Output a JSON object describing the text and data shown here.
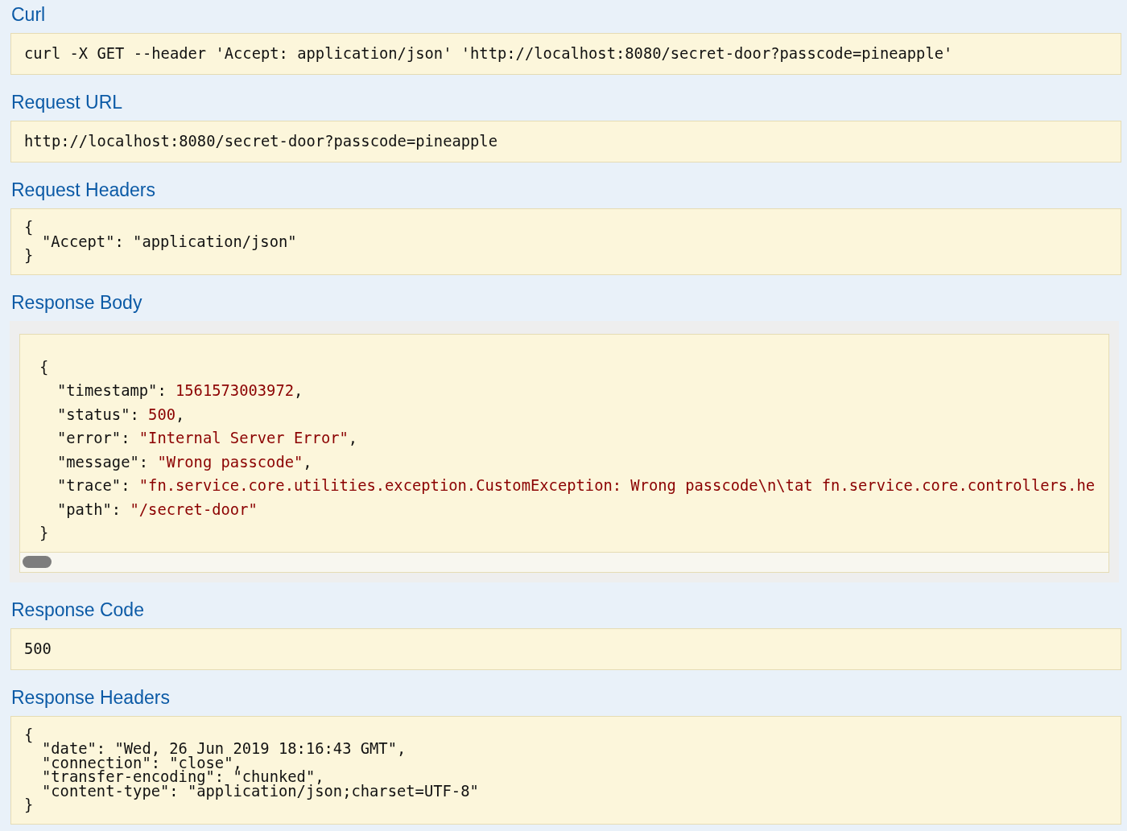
{
  "sections": [
    {
      "kind": "text",
      "title": "Curl",
      "lines": [
        "curl -X GET --header 'Accept: application/json' 'http://localhost:8080/secret-door?passcode=pineapple'"
      ]
    },
    {
      "kind": "text",
      "title": "Request URL",
      "lines": [
        "http://localhost:8080/secret-door?passcode=pineapple"
      ]
    },
    {
      "kind": "headers",
      "title": "Request Headers",
      "open": "{",
      "close": "}",
      "lines": [
        "\"Accept\": \"application/json\""
      ]
    },
    {
      "kind": "body",
      "title": "Response Body",
      "open": "{",
      "close": "}",
      "entries": [
        {
          "key": "\"timestamp\": ",
          "value": "1561573003972",
          "end": ","
        },
        {
          "key": "\"status\": ",
          "value": "500",
          "end": ","
        },
        {
          "key": "\"error\": ",
          "value": "\"Internal Server Error\"",
          "end": ","
        },
        {
          "key": "\"message\": ",
          "value": "\"Wrong passcode\"",
          "end": ","
        },
        {
          "key": "\"trace\": ",
          "value": "\"fn.service.core.utilities.exception.CustomException: Wrong passcode\\n\\tat fn.service.core.controllers.he"
        },
        {
          "key": "\"path\": ",
          "value": "\"/secret-door\""
        }
      ]
    },
    {
      "kind": "text",
      "title": "Response Code",
      "lines": [
        "500"
      ]
    },
    {
      "kind": "headers",
      "title": "Response Headers",
      "open": "{",
      "close": "}",
      "lines": [
        "\"date\": \"Wed, 26 Jun 2019 18:16:43 GMT\",",
        "\"connection\": \"close\",",
        "\"transfer-encoding\": \"chunked\",",
        "\"content-type\": \"application/json;charset=UTF-8\""
      ]
    }
  ]
}
